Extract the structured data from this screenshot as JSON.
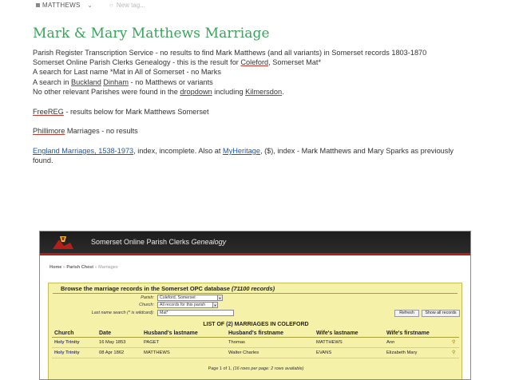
{
  "tagbar": {
    "tag_label": "MATTHEWS",
    "new_tag_placeholder": "New tag..."
  },
  "post": {
    "title": "Mark & Mary Matthews Marriage",
    "lines": {
      "l1": "Parish Register Transcription Service - no results to find Mark Matthews (and all variants) in Somerset records 1803-1870",
      "l2_a": "Somerset Online Parish Clerks Genealogy - this is the result for ",
      "l2_b": "Coleford",
      "l2_c": ", Somerset Mat*",
      "l3": "A search for Last name *Mat in All of Somerset - no Marks",
      "l4_a": "A search in ",
      "l4_b": "Buckland",
      "l4_c": " ",
      "l4_d": "Dinham",
      "l4_e": " - no Matthews or variants",
      "l5_a": "No other relevant Parishes were found in the ",
      "l5_b": "dropdown",
      "l5_c": " including ",
      "l5_d": "Kilmersdon",
      "l5_e": ".",
      "l6_a": "FreeREG",
      "l6_b": " - results below for Mark Matthews Somerset",
      "l7_a": "Phillimore",
      "l7_b": " Marriages - no results",
      "l8_a": "England Marriages, 1538-1973",
      "l8_b": ", index, incomplete. Also at ",
      "l8_c": "MyHeritage",
      "l8_d": ", ($), index - Mark Matthews and Mary Sparks as previously",
      "l8_e": "found."
    }
  },
  "opc": {
    "site_title_a": "Somerset Online Parish Clerks ",
    "site_title_b": "Genealogy",
    "crumb_home": "Home",
    "crumb_sep1": " » ",
    "crumb_chest": "Parish Chest",
    "crumb_sep2": " » ",
    "crumb_marriages": "Marriages",
    "panel_title_a": "Browse the marriage records in the Somerset OPC database ",
    "panel_title_b": "(71100 records)",
    "parish_label": "Parish:",
    "parish_value": "Coleford, Somerset",
    "church_label": "Church:",
    "church_value": "All records for this parish",
    "lastname_label": "Last name search (* is wildcard):",
    "lastname_value": "Mat*",
    "refresh_label": "Refresh",
    "show_all_label": "Show all records",
    "list_title": "LIST OF (2) MARRIAGES IN COLEFORD",
    "columns": [
      "Church",
      "Date",
      "Husband's lastname",
      "Husband's firstname",
      "Wife's lastname",
      "Wife's firstname"
    ],
    "rows": [
      [
        "Holy Trinity",
        "16 May 1853",
        "PAGET",
        "Thomas",
        "MATTHEWS",
        "Ann"
      ],
      [
        "Holy Trinity",
        "08 Apr 1862",
        "MATTHEWS",
        "Walter Charles",
        "EVANS",
        "Elizabeth Mary"
      ]
    ],
    "paging_a": "Page 1 of 1, ",
    "paging_b": "(16 rows per page: 2 rows available)",
    "colors": {
      "header_bg": "#222222",
      "accent_red": "#b3201a",
      "panel_bg": "#f6f1a9",
      "title_green": "#3aa35b",
      "link_blue": "#1a5aa8"
    }
  }
}
